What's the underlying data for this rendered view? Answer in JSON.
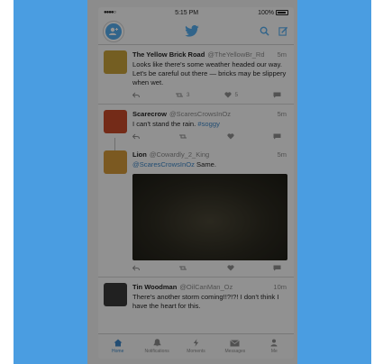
{
  "status": {
    "signal": "●●●●○",
    "carrier": "",
    "time": "5:15 PM",
    "battery": "100%"
  },
  "nav": {
    "title_icon": "twitter-bird-icon",
    "search_icon": "search-icon",
    "compose_icon": "compose-icon"
  },
  "tweets": [
    {
      "name": "The Yellow Brick Road",
      "handle": "@TheYellowBr_Rd",
      "time": "5m",
      "text": "Looks like there's some weather headed our way. Let's be careful out there — bricks may be slippery when wet.",
      "retweets": "3",
      "likes": "5"
    },
    {
      "name": "Scarecrow",
      "handle": "@ScaresCrowsInOz",
      "time": "5m",
      "text": "I can't stand the rain.",
      "hashtag": "#soggy",
      "retweets": "",
      "likes": ""
    },
    {
      "name": "Lion",
      "handle": "@Cowardly_2_King",
      "time": "5m",
      "mention": "@ScaresCrowsInOz",
      "text": "Same.",
      "retweets": "",
      "likes": ""
    },
    {
      "name": "Tin Woodman",
      "handle": "@OilCanMan_Oz",
      "time": "10m",
      "text": "There's another storm coming!!?!?! I don't think I have the heart for this."
    }
  ],
  "tabs": [
    {
      "label": "Home",
      "icon": "home-icon"
    },
    {
      "label": "Notifications",
      "icon": "bell-icon"
    },
    {
      "label": "Moments",
      "icon": "lightning-icon"
    },
    {
      "label": "Messages",
      "icon": "envelope-icon"
    },
    {
      "label": "Me",
      "icon": "person-icon"
    }
  ],
  "colors": {
    "accent": "#55acee",
    "link": "#3d86c6",
    "band": "#4a9de1"
  }
}
